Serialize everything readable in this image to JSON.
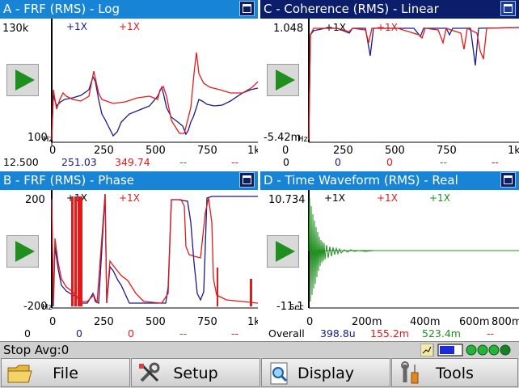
{
  "panels": {
    "a": {
      "title": "A - FRF (RMS) - Log",
      "legend": [
        "+1X",
        "+1X"
      ],
      "y_top": "130k",
      "y_bottom": "100",
      "y_bottom_unit": "Hz",
      "x_ticks": [
        "0",
        "250",
        "500",
        "750",
        "1k"
      ],
      "readouts": [
        "12.500",
        "251.03",
        "349.74",
        "--",
        "--"
      ]
    },
    "b": {
      "title": "B - FRF (RMS) - Phase",
      "legend": [
        "+1X",
        "+1X"
      ],
      "y_top": "200",
      "y_bottom": "-200",
      "y_bottom_unit": "Hz",
      "x_ticks": [
        "0",
        "250",
        "500",
        "750",
        "1k"
      ],
      "readouts": [
        "0",
        "0",
        "0",
        "--",
        "--"
      ]
    },
    "c": {
      "title": "C - Coherence (RMS) - Linear",
      "legend": [
        "+1X",
        "+1X"
      ],
      "y_top": "1.048",
      "y_bottom": "-5.42m",
      "y_bottom_unit": "Hz",
      "x_ticks": [
        "0",
        "250",
        "500",
        "750",
        "1k"
      ],
      "readouts": [
        "0",
        "0",
        "0",
        "--",
        "--"
      ]
    },
    "d": {
      "title": "D - Time Waveform (RMS) - Real",
      "legend": [
        "+1X",
        "+1X",
        "+1X"
      ],
      "y_top": "10.734",
      "y_bottom": "-11.1",
      "y_bottom_unit": "Sec",
      "x_ticks": [
        "0",
        "200m",
        "400m",
        "600m",
        "800m"
      ],
      "readouts": [
        "Overall",
        "398.8u",
        "155.2m",
        "523.4m",
        "--"
      ]
    }
  },
  "status": {
    "text": "Stop  Avg:0"
  },
  "buttons": {
    "file": "File",
    "setup": "Setup",
    "display": "Display",
    "tools": "Tools"
  },
  "colors": {
    "series_blue": "#1a1a8c",
    "series_red": "#e31a1a",
    "series_green": "#1f8f1f",
    "title_blue": "#1784d6",
    "title_active": "#0b1d6b"
  },
  "icons": [
    "folder-icon",
    "wrench-screwdriver-icon",
    "magnifier-document-icon",
    "tools-icon",
    "maximize-icon",
    "play-icon"
  ]
}
